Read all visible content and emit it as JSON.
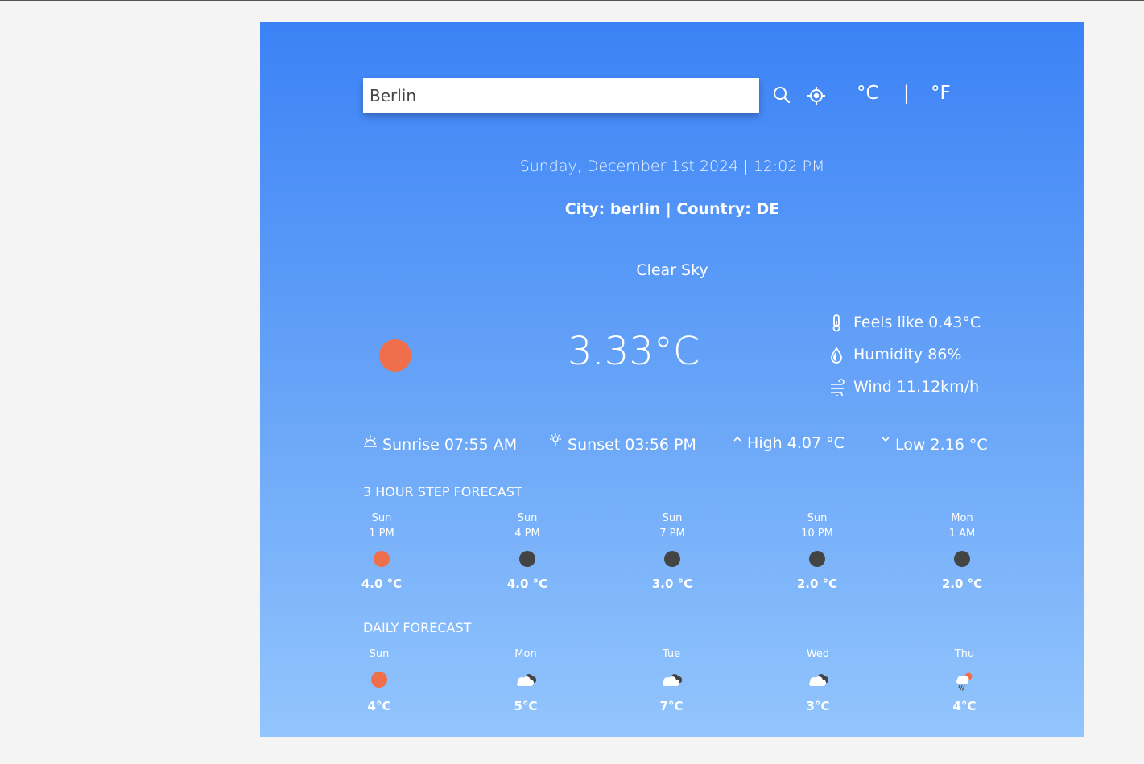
{
  "search": {
    "value": "Berlin",
    "placeholder": "search for city..."
  },
  "units": {
    "celsius": "°C",
    "separator": "|",
    "fahrenheit": "°F"
  },
  "datetime": "Sunday, December 1st 2024 | 12:02 PM",
  "location": "City: berlin | Country: DE",
  "condition": "Clear Sky",
  "current": {
    "temp": "3.33°C",
    "icon": "clear-sky-sun",
    "feels_like": "Feels like 0.43°C",
    "humidity": "Humidity 86%",
    "wind": "Wind 11.12km/h"
  },
  "sun": {
    "sunrise": "Sunrise 07:55 AM",
    "sunset": "Sunset 03:56 PM",
    "high": "High 4.07 °C",
    "low": "Low 2.16 °C"
  },
  "hourly": {
    "title": "3 HOUR STEP FORECAST",
    "items": [
      {
        "day": "Sun",
        "time": "1 PM",
        "temp": "4.0 °C",
        "icon": "sun"
      },
      {
        "day": "Sun",
        "time": "4 PM",
        "temp": "4.0 °C",
        "icon": "moon"
      },
      {
        "day": "Sun",
        "time": "7 PM",
        "temp": "3.0 °C",
        "icon": "moon"
      },
      {
        "day": "Sun",
        "time": "10 PM",
        "temp": "2.0 °C",
        "icon": "moon"
      },
      {
        "day": "Mon",
        "time": "1 AM",
        "temp": "2.0 °C",
        "icon": "moon"
      }
    ]
  },
  "daily": {
    "title": "DAILY FORECAST",
    "items": [
      {
        "day": "Sun",
        "temp": "4°C",
        "icon": "sun"
      },
      {
        "day": "Mon",
        "temp": "5°C",
        "icon": "clouds"
      },
      {
        "day": "Tue",
        "temp": "7°C",
        "icon": "clouds"
      },
      {
        "day": "Wed",
        "temp": "3°C",
        "icon": "clouds"
      },
      {
        "day": "Thu",
        "temp": "4°C",
        "icon": "rain-sun"
      }
    ]
  },
  "colors": {
    "sun": "#ef6f4c",
    "moon": "#444444",
    "gradient_top": "#3b82f6",
    "gradient_bottom": "#93c5fd"
  }
}
